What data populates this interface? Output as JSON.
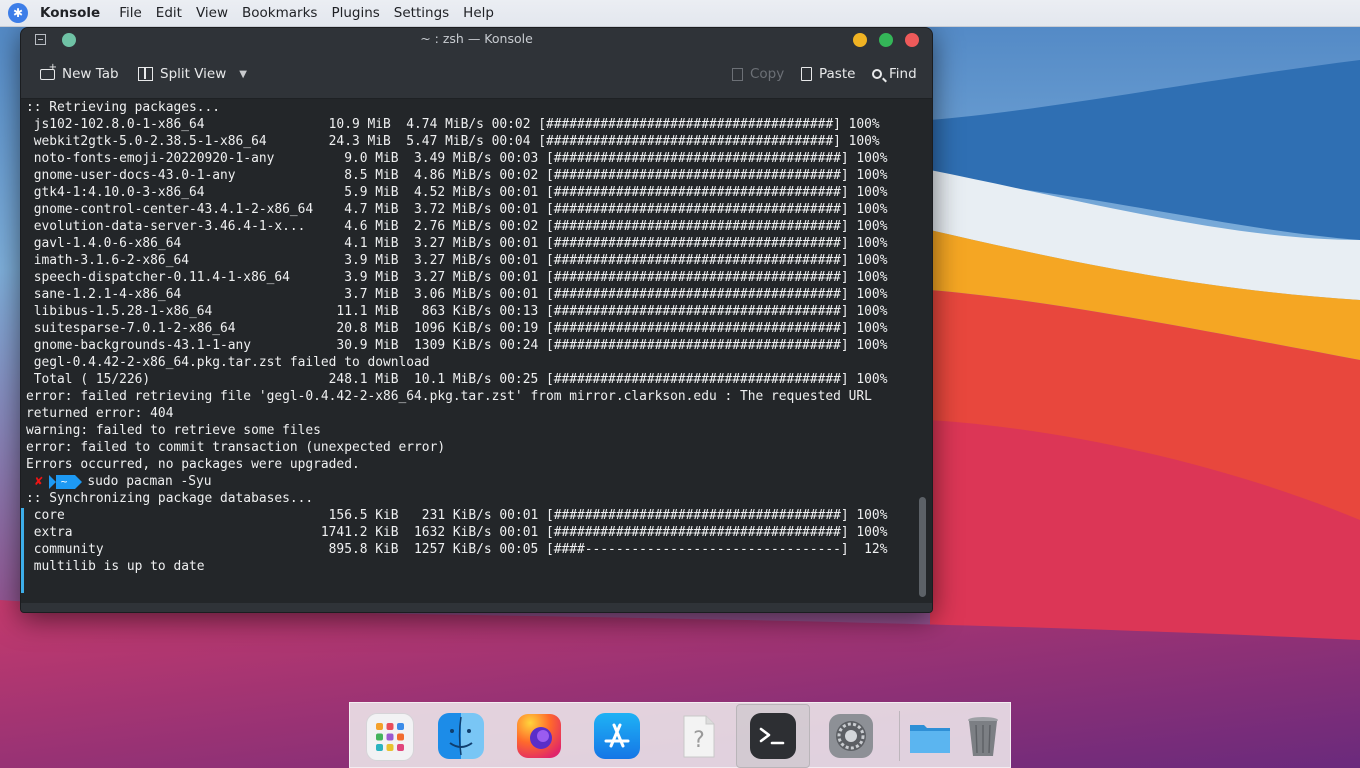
{
  "menubar": {
    "app_name": "Konsole",
    "items": [
      "File",
      "Edit",
      "View",
      "Bookmarks",
      "Plugins",
      "Settings",
      "Help"
    ]
  },
  "window": {
    "title": "~ : zsh — Konsole"
  },
  "toolbar": {
    "new_tab": "New Tab",
    "split_view": "Split View",
    "copy": "Copy",
    "paste": "Paste",
    "find": "Find"
  },
  "terminal": {
    "lines_before_prompt": [
      ":: Retrieving packages...",
      " js102-102.8.0-1-x86_64                10.9 MiB  4.74 MiB/s 00:02 [#####################################] 100%",
      " webkit2gtk-5.0-2.38.5-1-x86_64        24.3 MiB  5.47 MiB/s 00:04 [#####################################] 100%",
      " noto-fonts-emoji-20220920-1-any         9.0 MiB  3.49 MiB/s 00:03 [#####################################] 100%",
      " gnome-user-docs-43.0-1-any              8.5 MiB  4.86 MiB/s 00:02 [#####################################] 100%",
      " gtk4-1:4.10.0-3-x86_64                  5.9 MiB  4.52 MiB/s 00:01 [#####################################] 100%",
      " gnome-control-center-43.4.1-2-x86_64    4.7 MiB  3.72 MiB/s 00:01 [#####################################] 100%",
      " evolution-data-server-3.46.4-1-x...     4.6 MiB  2.76 MiB/s 00:02 [#####################################] 100%",
      " gavl-1.4.0-6-x86_64                     4.1 MiB  3.27 MiB/s 00:01 [#####################################] 100%",
      " imath-3.1.6-2-x86_64                    3.9 MiB  3.27 MiB/s 00:01 [#####################################] 100%",
      " speech-dispatcher-0.11.4-1-x86_64       3.9 MiB  3.27 MiB/s 00:01 [#####################################] 100%",
      " sane-1.2.1-4-x86_64                     3.7 MiB  3.06 MiB/s 00:01 [#####################################] 100%",
      " libibus-1.5.28-1-x86_64                11.1 MiB   863 KiB/s 00:13 [#####################################] 100%",
      " suitesparse-7.0.1-2-x86_64             20.8 MiB  1096 KiB/s 00:19 [#####################################] 100%",
      " gnome-backgrounds-43.1-1-any           30.9 MiB  1309 KiB/s 00:24 [#####################################] 100%",
      " gegl-0.4.42-2-x86_64.pkg.tar.zst failed to download",
      " Total ( 15/226)                       248.1 MiB  10.1 MiB/s 00:25 [#####################################] 100%",
      "error: failed retrieving file 'gegl-0.4.42-2-x86_64.pkg.tar.zst' from mirror.clarkson.edu : The requested URL",
      "returned error: 404",
      "warning: failed to retrieve some files",
      "error: failed to commit transaction (unexpected error)",
      "Errors occurred, no packages were upgraded."
    ],
    "prompt": {
      "status_symbol": "✘",
      "directory": "~",
      "command": "sudo pacman -Syu"
    },
    "lines_after_prompt": [
      ":: Synchronizing package databases...",
      " core                                  156.5 KiB   231 KiB/s 00:01 [#####################################] 100%",
      " extra                                1741.2 KiB  1632 KiB/s 00:01 [#####################################] 100%",
      " community                             895.8 KiB  1257 KiB/s 00:05 [####---------------------------------]  12%",
      " multilib is up to date"
    ]
  },
  "dock": {
    "items": [
      "launchpad-icon",
      "finder-icon",
      "firefox-icon",
      "app-store-icon",
      "unknown-file-icon",
      "terminal-icon",
      "system-settings-icon",
      "folder-icon",
      "trash-icon"
    ],
    "active_item": "terminal-icon"
  },
  "colors": {
    "terminal_bg": "#232629",
    "prompt_segment": "#1d99f3",
    "error_mark": "#ed1515",
    "scroll_marker": "#3daee9"
  }
}
